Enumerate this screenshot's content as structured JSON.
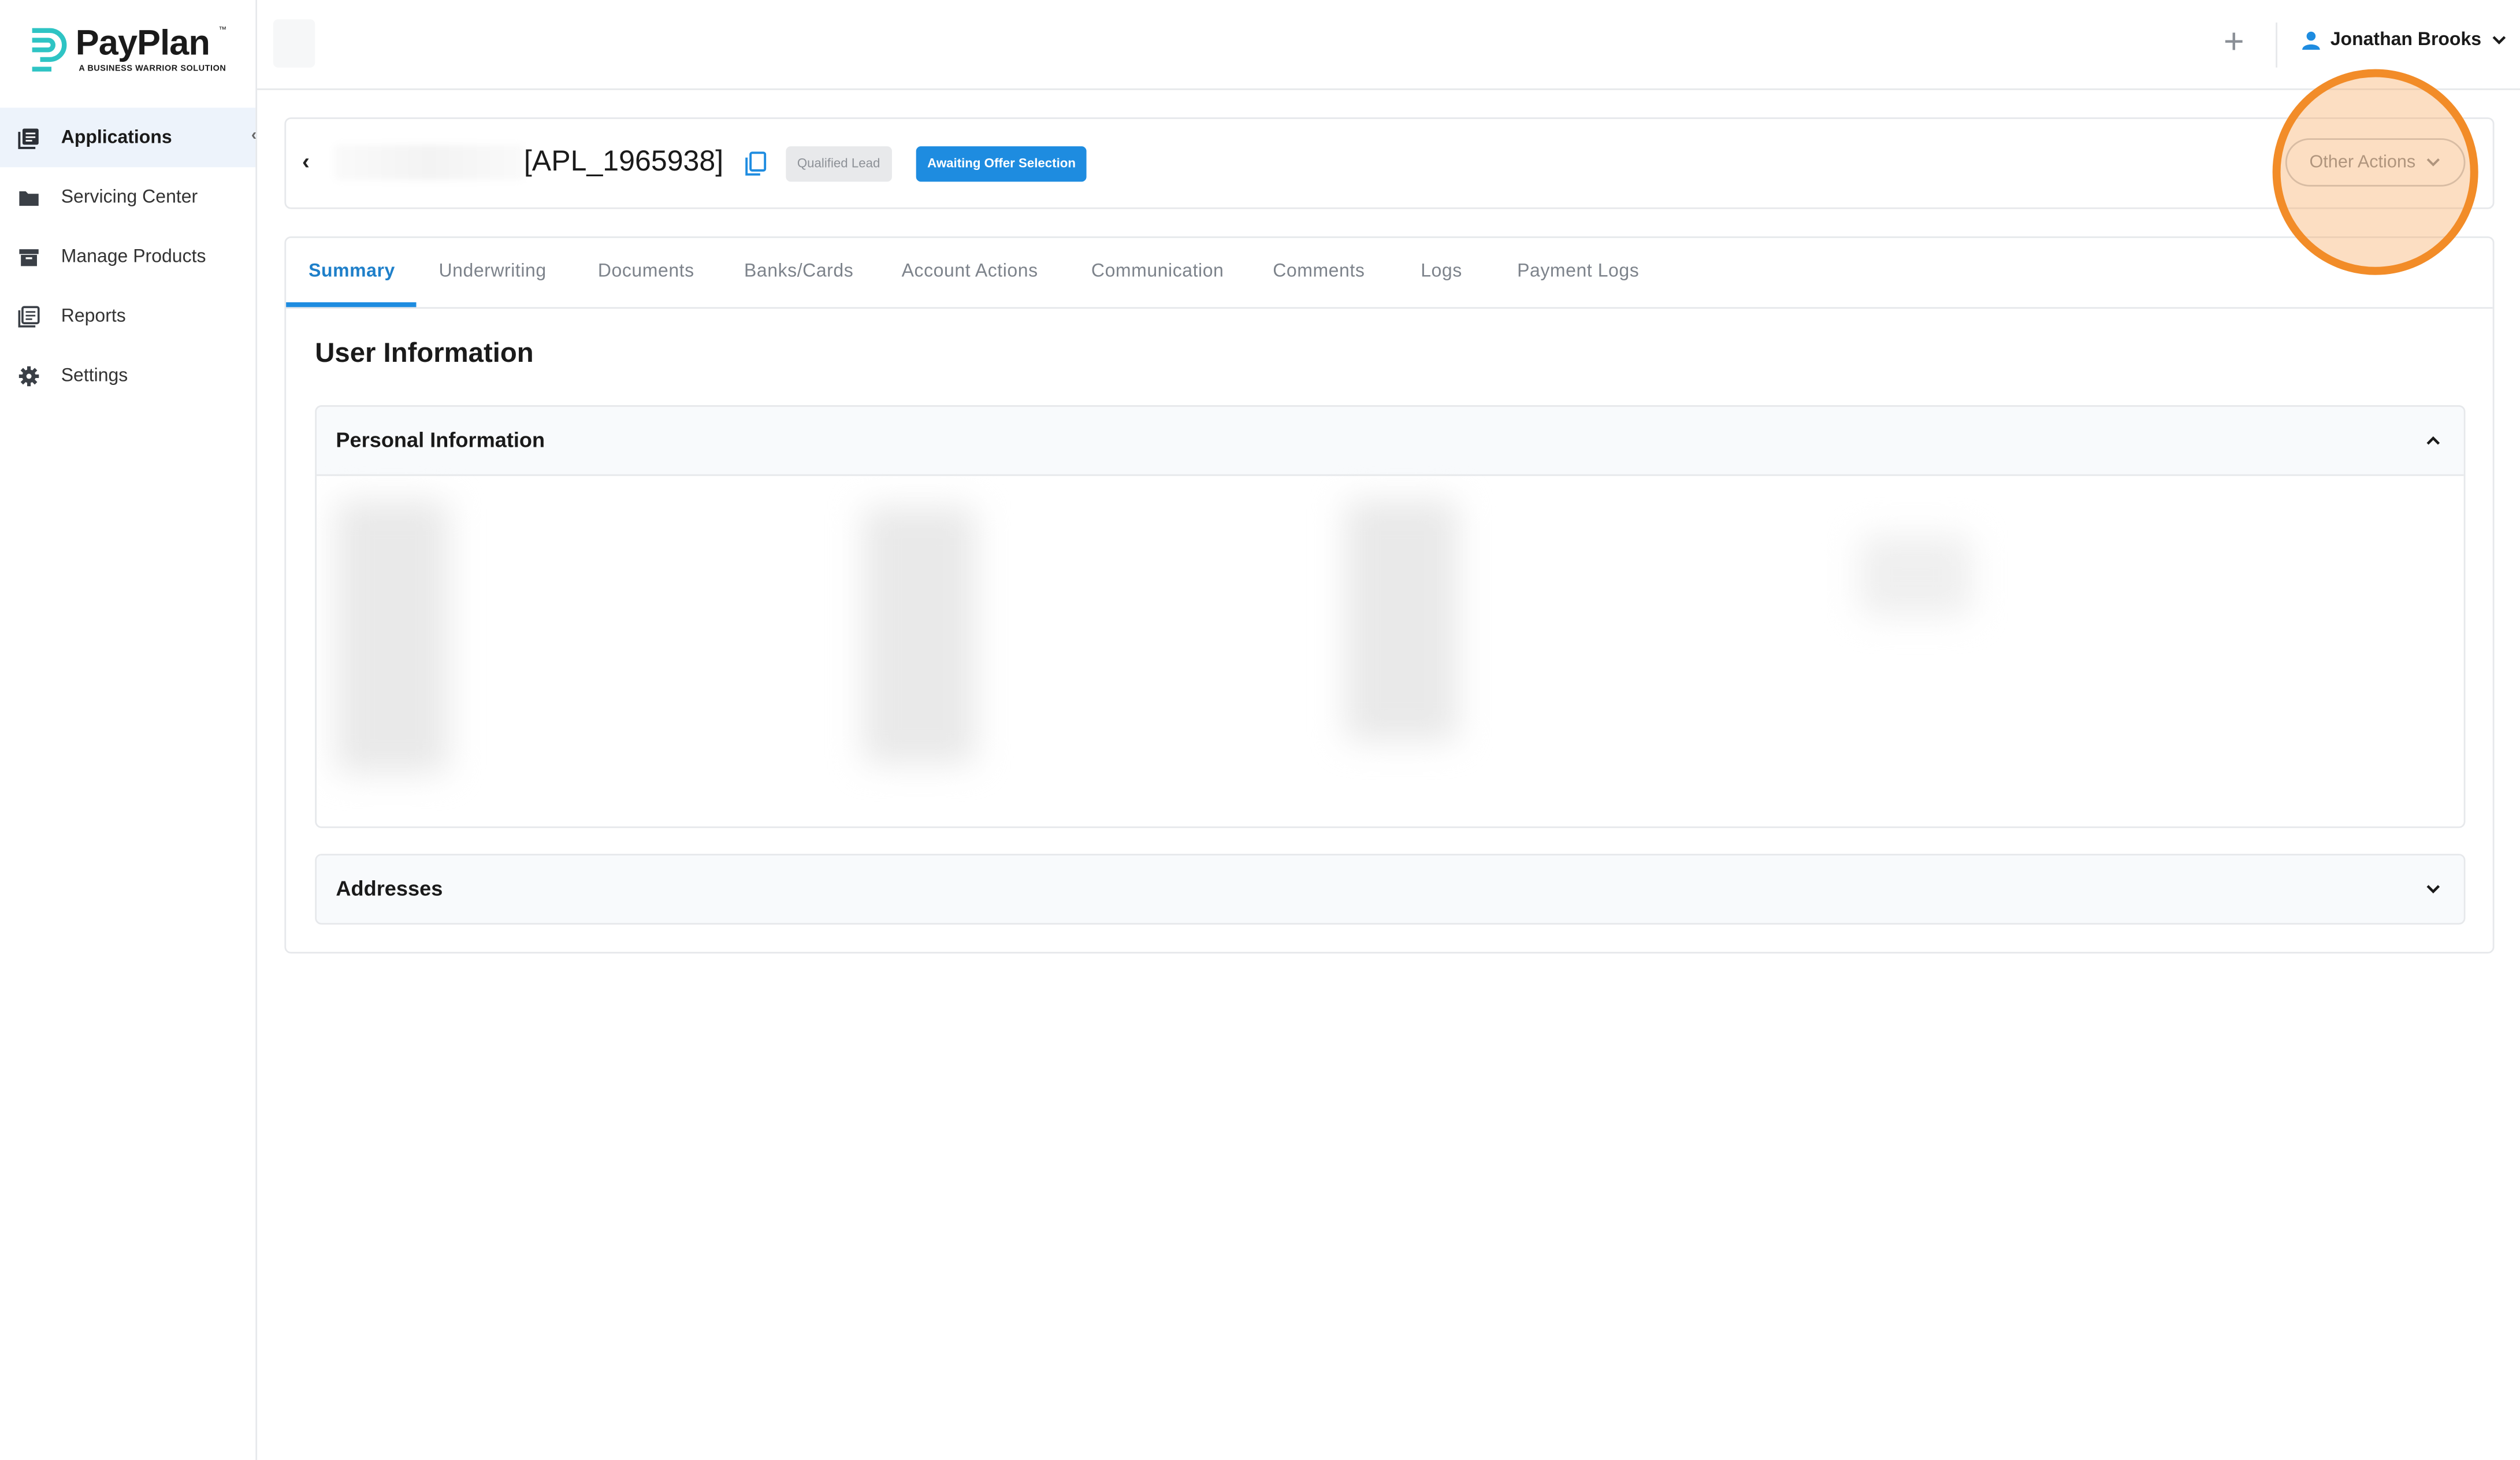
{
  "brand": {
    "name": "PayPlan",
    "trademark": "™",
    "tagline": "A BUSINESS WARRIOR SOLUTION",
    "accent_color": "#2ec4c4"
  },
  "sidebar": {
    "items": [
      {
        "label": "Applications",
        "icon": "applications-icon",
        "active": true
      },
      {
        "label": "Servicing Center",
        "icon": "folder-icon",
        "active": false
      },
      {
        "label": "Manage Products",
        "icon": "archive-box-icon",
        "active": false
      },
      {
        "label": "Reports",
        "icon": "reports-icon",
        "active": false
      },
      {
        "label": "Settings",
        "icon": "gear-icon",
        "active": false
      }
    ],
    "collapse_glyph": "‹"
  },
  "topbar": {
    "add_glyph": "+",
    "user_name": "Jonathan Brooks"
  },
  "header": {
    "back_glyph": "‹",
    "application_id": "[APL_1965938]",
    "badges": {
      "status_primary": "Qualified Lead",
      "status_secondary": "Awaiting Offer Selection"
    },
    "other_actions_label": "Other Actions"
  },
  "tabs": [
    {
      "label": "Summary",
      "active": true
    },
    {
      "label": "Underwriting",
      "active": false
    },
    {
      "label": "Documents",
      "active": false
    },
    {
      "label": "Banks/Cards",
      "active": false
    },
    {
      "label": "Account Actions",
      "active": false
    },
    {
      "label": "Communication",
      "active": false
    },
    {
      "label": "Comments",
      "active": false
    },
    {
      "label": "Logs",
      "active": false
    },
    {
      "label": "Payment Logs",
      "active": false
    }
  ],
  "content": {
    "section_title": "User Information",
    "panels": [
      {
        "title": "Personal Information",
        "expanded": true
      },
      {
        "title": "Addresses",
        "expanded": false
      }
    ]
  },
  "colors": {
    "primary": "#1e8ce0",
    "highlight": "#f28c28",
    "active_nav_bg": "#edf3fb"
  }
}
